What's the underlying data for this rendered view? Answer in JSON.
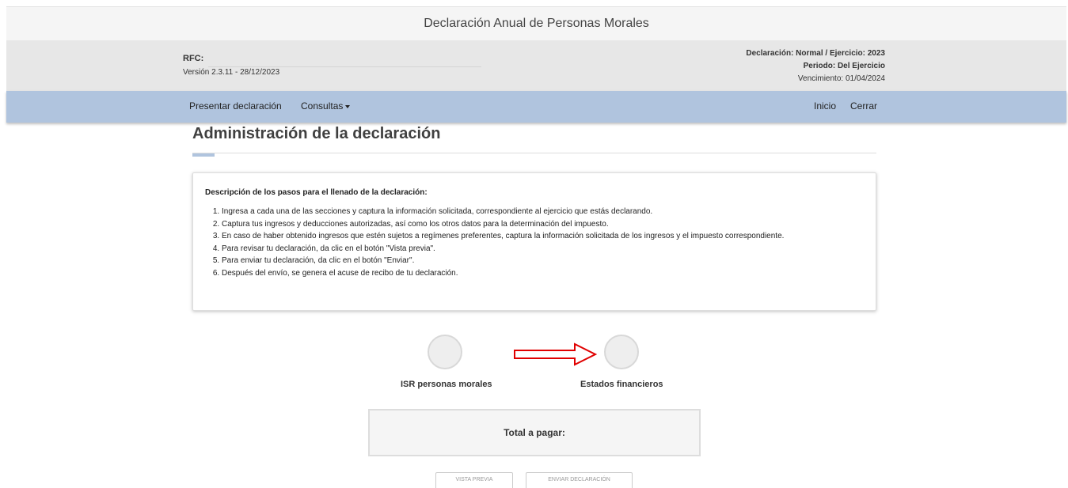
{
  "window": {
    "title": "Declaración Anual de Personas Morales"
  },
  "info": {
    "rfc_label": "RFC:",
    "rfc_value": "",
    "version": "Versión 2.3.11 - 28/12/2023",
    "declaracion": "Declaración: Normal / Ejercicio: 2023",
    "periodo": "Periodo: Del Ejercicio",
    "vencimiento": "Vencimiento: 01/04/2024"
  },
  "nav": {
    "presentar": "Presentar declaración",
    "consultas": "Consultas",
    "inicio": "Inicio",
    "cerrar": "Cerrar"
  },
  "main": {
    "title": "Administración de la declaración",
    "instructions": {
      "heading": "Descripción de los pasos para el llenado de la declaración:",
      "steps": [
        "Ingresa a cada una de las secciones y captura la información solicitada, correspondiente al ejercicio que estás declarando.",
        "Captura tus ingresos y deducciones autorizadas, así como los otros datos para la determinación del impuesto.",
        "En caso de haber obtenido ingresos que estén sujetos a regímenes preferentes, captura la información solicitada de los ingresos y el impuesto correspondiente.",
        "Para revisar tu declaración, da clic en el botón \"Vista previa\".",
        "Para enviar tu declaración, da clic en el botón \"Enviar\".",
        "Después del envío, se genera el acuse de recibo de tu declaración."
      ]
    },
    "sections": [
      {
        "label": "ISR personas morales"
      },
      {
        "label": "Estados financieros"
      }
    ],
    "total_label": "Total a pagar:",
    "buttons": {
      "preview": "VISTA PREVIA",
      "send": "ENVIAR DECLARACIÓN"
    }
  },
  "colors": {
    "nav_bar": "#b0c4de",
    "annotation_arrow": "#e00000"
  }
}
